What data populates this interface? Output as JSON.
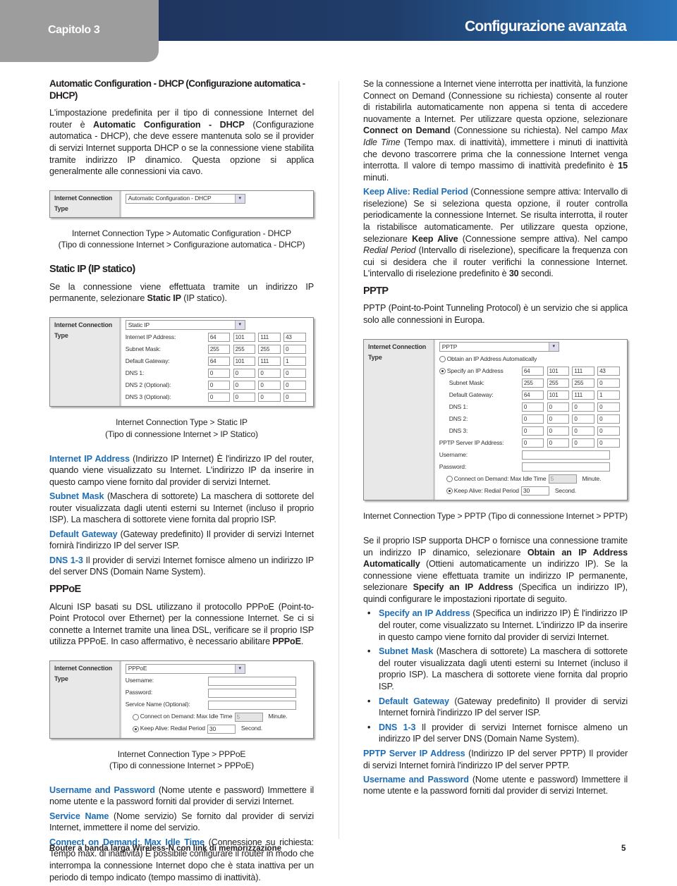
{
  "header": {
    "chapter": "Capitolo 3",
    "title": "Configurazione avanzata",
    "colors": {
      "tab": "#9d9d9e",
      "bar_start": "#1f355f",
      "bar_end": "#2a74ba",
      "accent": "#1f6db3"
    }
  },
  "left": [
    {
      "type": "h",
      "first": true,
      "text": "Automatic Configuration - DHCP (Configurazione automatica - DHCP)"
    },
    {
      "type": "p",
      "runs": [
        "L'impostazione predefinita per il tipo di connessione Internet del router è ",
        {
          "t": "Automatic Configuration - DHCP",
          "s": "b"
        },
        " (Configurazione automatica - DHCP), che deve essere mantenuta solo se il provider di servizi Internet supporta DHCP o se la connessione viene stabilita tramite indirizzo IP dinamico. Questa opzione si applica generalmente alle connessioni via cavo."
      ]
    },
    {
      "type": "fig",
      "name": "dhcp",
      "label": "Internet Connection Type",
      "select": "Automatic Configuration - DHCP",
      "rows": []
    },
    {
      "type": "cap",
      "lines": [
        "Internet Connection Type > Automatic Configuration - DHCP",
        "(Tipo di connessione Internet > Configurazione automatica - DHCP)"
      ]
    },
    {
      "type": "h",
      "text": "Static IP (IP statico)"
    },
    {
      "type": "p",
      "runs": [
        "Se la connessione viene effettuata tramite un indirizzo IP permanente, selezionare ",
        {
          "t": "Static IP",
          "s": "b"
        },
        " (IP statico)."
      ]
    },
    {
      "type": "fig",
      "name": "static-ip",
      "label": "Internet Connection Type",
      "select": "Static IP",
      "rows": [
        {
          "k": "ip",
          "label": "Internet IP  Address:",
          "ip": [
            "64",
            "101",
            "111",
            "43"
          ]
        },
        {
          "k": "ip",
          "label": "Subnet Mask:",
          "ip": [
            "255",
            "255",
            "255",
            "0"
          ]
        },
        {
          "k": "ip",
          "label": "Default Gateway:",
          "ip": [
            "64",
            "101",
            "111",
            "1"
          ]
        },
        {
          "k": "ip",
          "label": "DNS 1:",
          "ip": [
            "0",
            "0",
            "0",
            "0"
          ]
        },
        {
          "k": "ip",
          "label": "DNS 2 (Optional):",
          "ip": [
            "0",
            "0",
            "0",
            "0"
          ]
        },
        {
          "k": "ip",
          "label": "DNS 3 (Optional):",
          "ip": [
            "0",
            "0",
            "0",
            "0"
          ]
        }
      ]
    },
    {
      "type": "cap",
      "lines": [
        "Internet Connection Type > Static IP",
        "(Tipo di connessione Internet > IP Statico)"
      ]
    },
    {
      "type": "p",
      "runs": [
        {
          "t": "Internet IP Address",
          "s": "blue"
        },
        " (Indirizzo IP Internet) È l'indirizzo IP del router, quando viene visualizzato su Internet. L'indirizzo IP da inserire in questo campo viene fornito dal provider di servizi Internet."
      ]
    },
    {
      "type": "p",
      "runs": [
        {
          "t": "Subnet Mask",
          "s": "blue"
        },
        " (Maschera di sottorete) La maschera di sottorete del router visualizzata dagli utenti esterni su Internet (incluso il proprio ISP). La maschera di sottorete viene fornita dal proprio ISP."
      ]
    },
    {
      "type": "p",
      "runs": [
        {
          "t": "Default Gateway",
          "s": "blue"
        },
        " (Gateway predefinito) Il provider di servizi Internet fornirà l'indirizzo IP del server ISP."
      ]
    },
    {
      "type": "p",
      "runs": [
        {
          "t": "DNS 1-3",
          "s": "blue"
        },
        " Il provider di servizi Internet fornisce almeno un indirizzo IP del server DNS (Domain Name System)."
      ]
    },
    {
      "type": "h",
      "text": "PPPoE"
    },
    {
      "type": "p",
      "runs": [
        "Alcuni ISP basati su DSL utilizzano il protocollo PPPoE (Point-to-Point Protocol over Ethernet) per la connessione Internet. Se ci si connette a Internet tramite una linea DSL, verificare se il proprio ISP utilizza PPPoE. In caso affermativo, è necessario abilitare ",
        {
          "t": "PPPoE",
          "s": "b"
        },
        "."
      ]
    },
    {
      "type": "fig",
      "name": "pppoe",
      "label": "Internet Connection Type",
      "select": "PPPoE",
      "rows": [
        {
          "k": "text",
          "label": "Username:"
        },
        {
          "k": "text",
          "label": "Password:"
        },
        {
          "k": "text",
          "label": "Service Name (Optional):"
        },
        {
          "k": "radio",
          "label": "Connect on Demand: Max Idle Time",
          "checked": false,
          "value": "5",
          "unit": "Minute.",
          "disabled": true
        },
        {
          "k": "radio",
          "label": "Keep Alive: Redial Period",
          "checked": true,
          "value": "30",
          "unit": "Second.",
          "disabled": false
        }
      ]
    },
    {
      "type": "cap",
      "lines": [
        "Internet Connection Type > PPPoE",
        "(Tipo di connessione Internet > PPPoE)"
      ]
    },
    {
      "type": "p",
      "runs": [
        {
          "t": "Username and Password",
          "s": "blue"
        },
        " (Nome utente e password) Immettere il nome utente e la password forniti dal provider di servizi Internet."
      ]
    },
    {
      "type": "p",
      "runs": [
        {
          "t": "Service Name",
          "s": "blue"
        },
        " (Nome servizio) Se fornito dal provider di servizi Internet, immettere il nome del servizio."
      ]
    },
    {
      "type": "p",
      "runs": [
        {
          "t": "Connect on Demand: Max Idle Time",
          "s": "blue"
        },
        " (Connessione su richiesta: Tempo max. di inattività) È possibile configurare il router in modo che interrompa la connessione Internet dopo che è stata inattiva per un periodo di tempo indicato (tempo massimo di inattività)."
      ]
    }
  ],
  "right": [
    {
      "type": "p",
      "runs": [
        "Se la connessione a Internet viene interrotta per inattività, la funzione Connect on Demand (Connessione su richiesta) consente al router di ristabilirla automaticamente non appena si tenta di accedere nuovamente a Internet. Per utilizzare questa opzione, selezionare ",
        {
          "t": "Connect on Demand",
          "s": "b"
        },
        " (Connessione su richiesta). Nel campo ",
        {
          "t": "Max Idle Time",
          "s": "i"
        },
        " (Tempo max. di inattività), immettere i minuti di inattività che devono trascorrere prima che la connessione Internet venga interrotta. Il valore di tempo massimo di inattività predefinito è ",
        {
          "t": "15",
          "s": "b"
        },
        " minuti."
      ]
    },
    {
      "type": "p",
      "runs": [
        {
          "t": "Keep Alive: Redial Period",
          "s": "blue"
        },
        " (Connessione sempre attiva: Intervallo di riselezione) Se si seleziona questa opzione, il router controlla periodicamente la connessione Internet. Se risulta interrotta, il router la ristabilisce automaticamente. Per utilizzare questa opzione, selezionare ",
        {
          "t": "Keep Alive",
          "s": "b"
        },
        " (Connessione sempre attiva). Nel campo ",
        {
          "t": "Redial Period",
          "s": "i"
        },
        " (Intervallo di riselezione), specificare la frequenza con cui si desidera che il router verifichi la connessione Internet. L'intervallo di riselezione predefinito è ",
        {
          "t": "30",
          "s": "b"
        },
        " secondi."
      ]
    },
    {
      "type": "h",
      "text": "PPTP"
    },
    {
      "type": "p",
      "runs": [
        "PPTP (Point-to-Point Tunneling Protocol) è un servizio che si applica solo alle connessioni in Europa."
      ]
    },
    {
      "type": "fig",
      "name": "pptp",
      "label": "Internet Connection Type",
      "select": "PPTP",
      "rows": [
        {
          "k": "radioonly",
          "label": "Obtain an IP Address Automatically",
          "checked": false
        },
        {
          "k": "ip",
          "label": "Specify an IP Address",
          "radio": true,
          "checked": true,
          "ip": [
            "64",
            "101",
            "111",
            "43"
          ]
        },
        {
          "k": "ip",
          "label": "Subnet Mask:",
          "indent": true,
          "ip": [
            "255",
            "255",
            "255",
            "0"
          ]
        },
        {
          "k": "ip",
          "label": "Default Gateway:",
          "indent": true,
          "ip": [
            "64",
            "101",
            "111",
            "1"
          ]
        },
        {
          "k": "ip",
          "label": "DNS 1:",
          "indent": true,
          "ip": [
            "0",
            "0",
            "0",
            "0"
          ]
        },
        {
          "k": "ip",
          "label": "DNS 2:",
          "indent": true,
          "ip": [
            "0",
            "0",
            "0",
            "0"
          ]
        },
        {
          "k": "ip",
          "label": "DNS 3:",
          "indent": true,
          "ip": [
            "0",
            "0",
            "0",
            "0"
          ]
        },
        {
          "k": "ip",
          "label": "PPTP Server IP Address:",
          "ip": [
            "0",
            "0",
            "0",
            "0"
          ]
        },
        {
          "k": "text",
          "label": "Username:"
        },
        {
          "k": "text",
          "label": "Password:"
        },
        {
          "k": "radio",
          "label": "Connect on Demand: Max Idle Time",
          "checked": false,
          "value": "5",
          "unit": "Minute.",
          "disabled": true
        },
        {
          "k": "radio",
          "label": "Keep Alive: Redial Period",
          "checked": true,
          "value": "30",
          "unit": "Second.",
          "disabled": false
        }
      ]
    },
    {
      "type": "cap",
      "lines": [
        "Internet Connection Type > PPTP (Tipo di connessione Internet > PPTP)"
      ]
    },
    {
      "type": "p",
      "runs": [
        "Se il proprio ISP supporta DHCP o fornisce una connessione tramite un indirizzo IP dinamico, selezionare ",
        {
          "t": "Obtain an IP Address Automatically",
          "s": "b"
        },
        " (Ottieni automaticamente un indirizzo IP). Se la connessione viene effettuata tramite un indirizzo IP permanente, selezionare ",
        {
          "t": "Specify an IP Address",
          "s": "b"
        },
        " (Specifica un indirizzo IP), quindi configurare le impostazioni riportate di seguito."
      ]
    },
    {
      "type": "ul",
      "items": [
        [
          {
            "t": "Specify an IP Address",
            "s": "blue"
          },
          " (Specifica un indirizzo IP) È l'indirizzo IP del router, come visualizzato su Internet. L'indirizzo IP da inserire in questo campo viene fornito dal provider di servizi Internet."
        ],
        [
          {
            "t": "Subnet Mask",
            "s": "blue"
          },
          " (Maschera di sottorete) La maschera di sottorete del router visualizzata dagli utenti esterni su Internet (incluso il proprio ISP). La maschera di sottorete viene fornita dal proprio ISP."
        ],
        [
          {
            "t": "Default Gateway",
            "s": "blue"
          },
          " (Gateway predefinito) Il provider di servizi Internet fornirà l'indirizzo IP del server ISP."
        ],
        [
          {
            "t": "DNS 1-3",
            "s": "blue"
          },
          " Il provider di servizi Internet fornisce almeno un indirizzo IP del server DNS (Domain Name System)."
        ]
      ]
    },
    {
      "type": "p",
      "runs": [
        {
          "t": "PPTP Server IP Address",
          "s": "blue"
        },
        " (Indirizzo IP del server PPTP) Il provider di servizi Internet fornirà l'indirizzo IP del server PPTP."
      ]
    },
    {
      "type": "p",
      "runs": [
        {
          "t": "Username and Password",
          "s": "blue"
        },
        " (Nome utente e password) Immettere il nome utente e la password forniti dal provider di servizi Internet."
      ]
    }
  ],
  "footer": {
    "product": "Router a banda larga Wireless-N con link di memorizzazione",
    "page": "5"
  }
}
